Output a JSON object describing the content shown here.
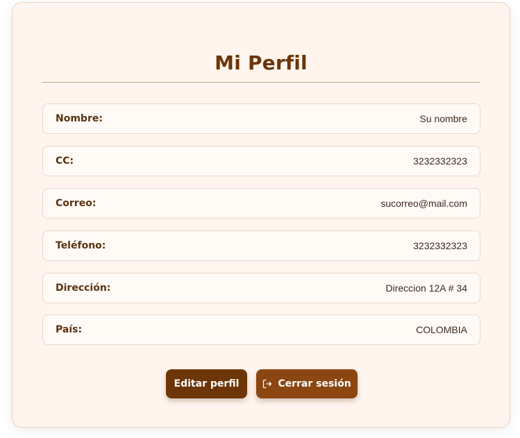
{
  "profile": {
    "title": "Mi Perfil",
    "fields": [
      {
        "label": "Nombre:",
        "value": "Su nombre"
      },
      {
        "label": "CC:",
        "value": "3232332323"
      },
      {
        "label": "Correo:",
        "value": "sucorreo@mail.com"
      },
      {
        "label": "Teléfono:",
        "value": "3232332323"
      },
      {
        "label": "Dirección:",
        "value": "Direccion 12A # 34"
      },
      {
        "label": "País:",
        "value": "COLOMBIA"
      }
    ]
  },
  "actions": {
    "edit_label": "Editar perfil",
    "logout_label": "Cerrar sesión",
    "logout_icon": "logout-icon"
  },
  "colors": {
    "accent": "#6d3608",
    "accent_light": "#8b4612",
    "card_background": "#fff5ee"
  }
}
